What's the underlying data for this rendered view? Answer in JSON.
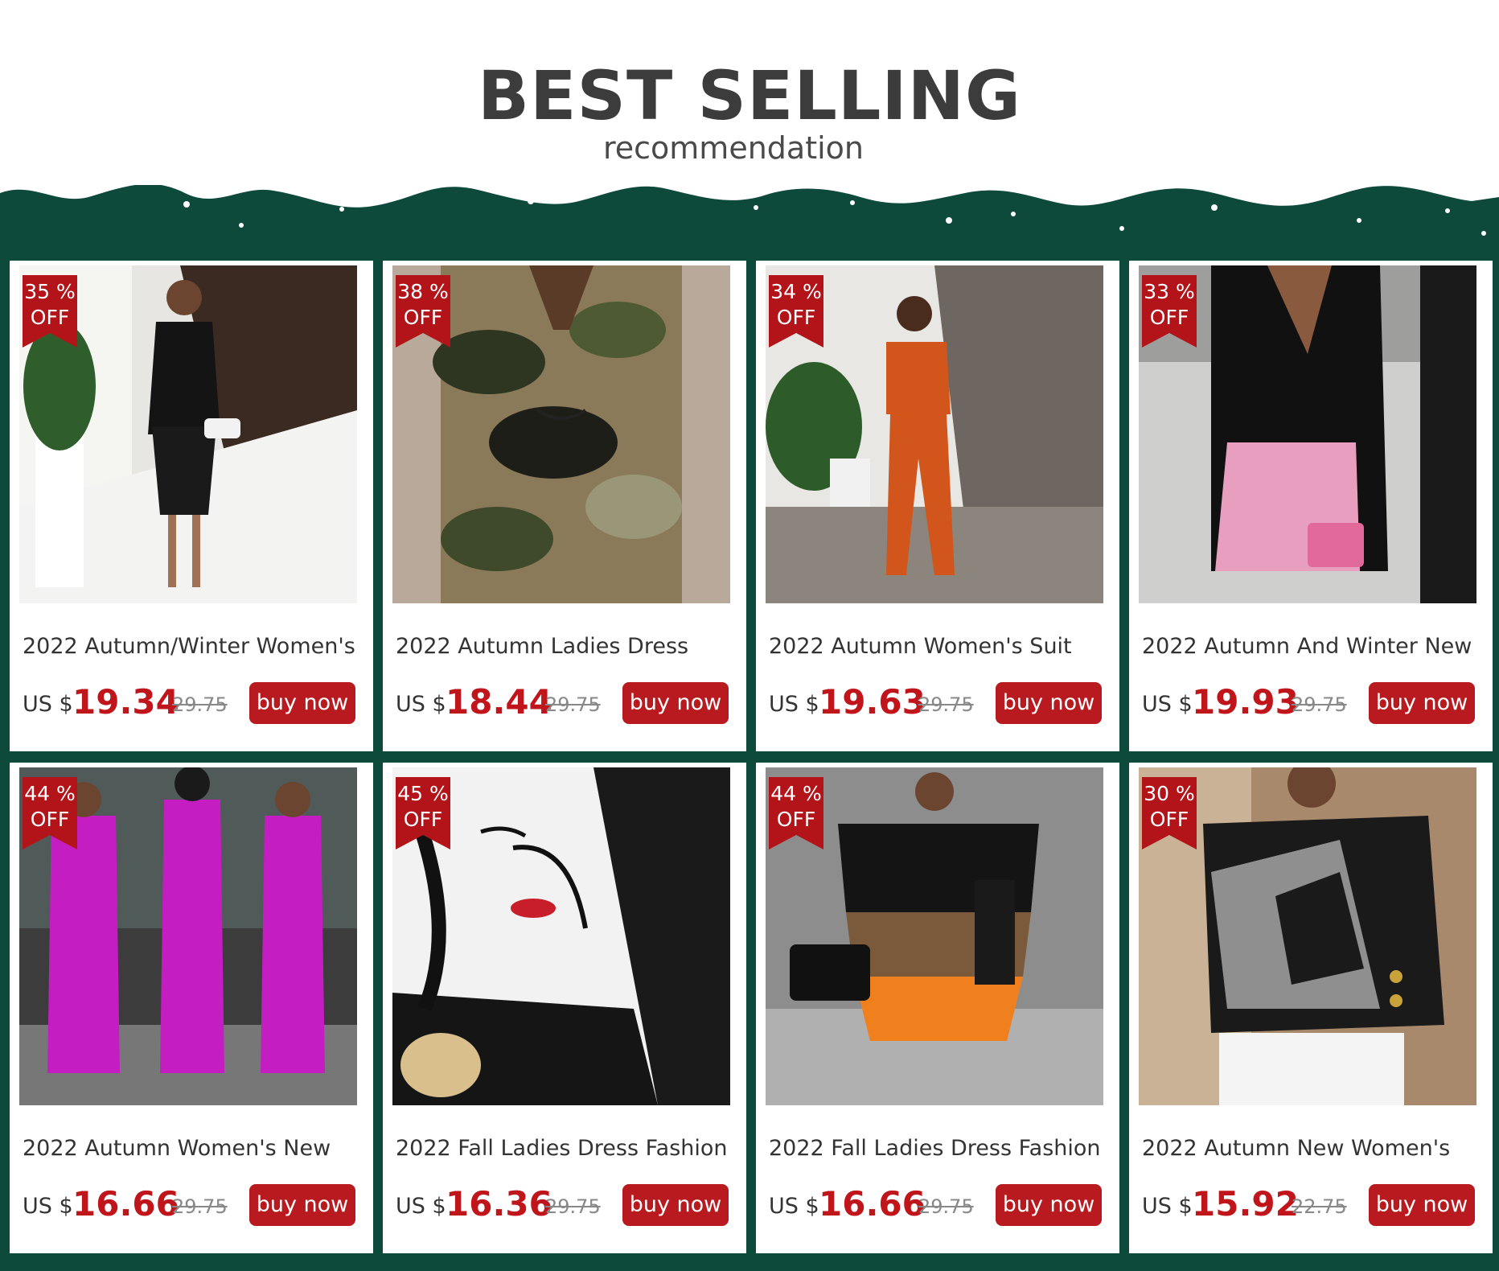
{
  "header": {
    "title": "BEST SELLING",
    "subtitle": "recommendation"
  },
  "products": [
    {
      "name": "2022 Autumn/Winter Women's",
      "currency": "US $",
      "price": "19.34",
      "old_price": "29.75",
      "discount_pct": "35 %",
      "discount_off": "OFF",
      "button": "buy now"
    },
    {
      "name": "2022 Autumn Ladies Dress",
      "currency": "US $",
      "price": "18.44",
      "old_price": "29.75",
      "discount_pct": "38 %",
      "discount_off": "OFF",
      "button": "buy now"
    },
    {
      "name": "2022 Autumn Women's Suit",
      "currency": "US $",
      "price": "19.63",
      "old_price": "29.75",
      "discount_pct": "34 %",
      "discount_off": "OFF",
      "button": "buy now"
    },
    {
      "name": "2022 Autumn And Winter New",
      "currency": "US $",
      "price": "19.93",
      "old_price": "29.75",
      "discount_pct": "33 %",
      "discount_off": "OFF",
      "button": "buy now"
    },
    {
      "name": "2022 Autumn Women's New",
      "currency": "US $",
      "price": "16.66",
      "old_price": "29.75",
      "discount_pct": "44 %",
      "discount_off": "OFF",
      "button": "buy now"
    },
    {
      "name": "2022 Fall Ladies Dress Fashion",
      "currency": "US $",
      "price": "16.36",
      "old_price": "29.75",
      "discount_pct": "45 %",
      "discount_off": "OFF",
      "button": "buy now"
    },
    {
      "name": "2022 Fall Ladies Dress Fashion",
      "currency": "US $",
      "price": "16.66",
      "old_price": "29.75",
      "discount_pct": "44 %",
      "discount_off": "OFF",
      "button": "buy now"
    },
    {
      "name": "2022 Autumn New Women's",
      "currency": "US $",
      "price": "15.92",
      "old_price": "22.75",
      "discount_pct": "30 %",
      "discount_off": "OFF",
      "button": "buy now"
    }
  ],
  "colors": {
    "background_green": "#0e4a3c",
    "price_red": "#c0161b",
    "button_red": "#b91a1f",
    "title_gray": "#3c3c3c"
  }
}
